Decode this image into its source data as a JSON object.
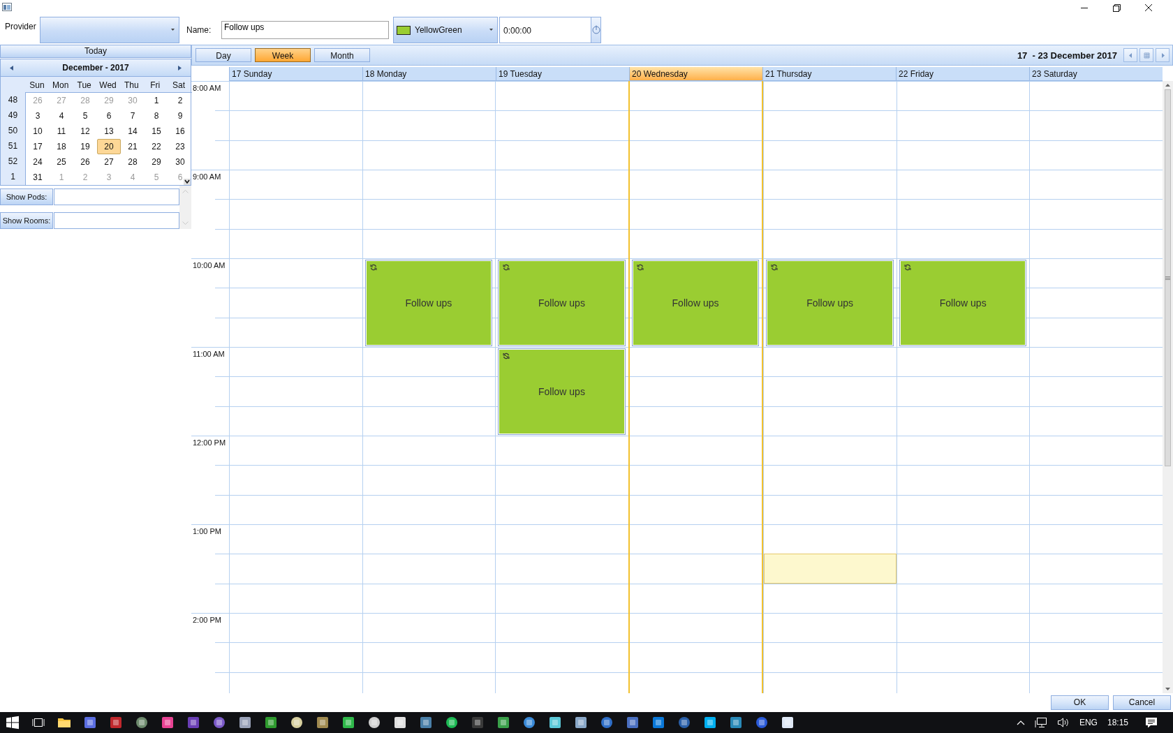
{
  "toolbar": {
    "provider_label": "Provider",
    "name_label": "Name:",
    "name_value": "Follow ups",
    "category": {
      "label": "YellowGreen",
      "color": "#9acd32"
    },
    "time_value": "0:00:00"
  },
  "sidebar": {
    "today_button": "Today",
    "month_title": "December - 2017",
    "weekdays": [
      "Sun",
      "Mon",
      "Tue",
      "Wed",
      "Thu",
      "Fri",
      "Sat"
    ],
    "weeks": [
      {
        "number": "48",
        "days": [
          {
            "label": "26",
            "other_month": true,
            "selected": false
          },
          {
            "label": "27",
            "other_month": true,
            "selected": false
          },
          {
            "label": "28",
            "other_month": true,
            "selected": false
          },
          {
            "label": "29",
            "other_month": true,
            "selected": false
          },
          {
            "label": "30",
            "other_month": true,
            "selected": false
          },
          {
            "label": "1",
            "other_month": false,
            "selected": false
          },
          {
            "label": "2",
            "other_month": false,
            "selected": false
          }
        ]
      },
      {
        "number": "49",
        "days": [
          {
            "label": "3",
            "other_month": false,
            "selected": false
          },
          {
            "label": "4",
            "other_month": false,
            "selected": false
          },
          {
            "label": "5",
            "other_month": false,
            "selected": false
          },
          {
            "label": "6",
            "other_month": false,
            "selected": false
          },
          {
            "label": "7",
            "other_month": false,
            "selected": false
          },
          {
            "label": "8",
            "other_month": false,
            "selected": false
          },
          {
            "label": "9",
            "other_month": false,
            "selected": false
          }
        ]
      },
      {
        "number": "50",
        "days": [
          {
            "label": "10",
            "other_month": false,
            "selected": false
          },
          {
            "label": "11",
            "other_month": false,
            "selected": false
          },
          {
            "label": "12",
            "other_month": false,
            "selected": false
          },
          {
            "label": "13",
            "other_month": false,
            "selected": false
          },
          {
            "label": "14",
            "other_month": false,
            "selected": false
          },
          {
            "label": "15",
            "other_month": false,
            "selected": false
          },
          {
            "label": "16",
            "other_month": false,
            "selected": false
          }
        ]
      },
      {
        "number": "51",
        "days": [
          {
            "label": "17",
            "other_month": false,
            "selected": false
          },
          {
            "label": "18",
            "other_month": false,
            "selected": false
          },
          {
            "label": "19",
            "other_month": false,
            "selected": false
          },
          {
            "label": "20",
            "other_month": false,
            "selected": true
          },
          {
            "label": "21",
            "other_month": false,
            "selected": false
          },
          {
            "label": "22",
            "other_month": false,
            "selected": false
          },
          {
            "label": "23",
            "other_month": false,
            "selected": false
          }
        ]
      },
      {
        "number": "52",
        "days": [
          {
            "label": "24",
            "other_month": false,
            "selected": false
          },
          {
            "label": "25",
            "other_month": false,
            "selected": false
          },
          {
            "label": "26",
            "other_month": false,
            "selected": false
          },
          {
            "label": "27",
            "other_month": false,
            "selected": false
          },
          {
            "label": "28",
            "other_month": false,
            "selected": false
          },
          {
            "label": "29",
            "other_month": false,
            "selected": false
          },
          {
            "label": "30",
            "other_month": false,
            "selected": false
          }
        ]
      },
      {
        "number": "1",
        "days": [
          {
            "label": "31",
            "other_month": false,
            "selected": false
          },
          {
            "label": "1",
            "other_month": true,
            "selected": false
          },
          {
            "label": "2",
            "other_month": true,
            "selected": false
          },
          {
            "label": "3",
            "other_month": true,
            "selected": false
          },
          {
            "label": "4",
            "other_month": true,
            "selected": false
          },
          {
            "label": "5",
            "other_month": true,
            "selected": false
          },
          {
            "label": "6",
            "other_month": true,
            "selected": false
          }
        ]
      }
    ],
    "filters": [
      {
        "label": "Show Pods:"
      },
      {
        "label": "Show Rooms:"
      }
    ]
  },
  "scheduler": {
    "views": [
      {
        "label": "Day",
        "selected": false
      },
      {
        "label": "Week",
        "selected": true
      },
      {
        "label": "Month",
        "selected": false
      }
    ],
    "range_title": "17  - 23 December 2017",
    "days": [
      {
        "label": "17 Sunday",
        "today": false
      },
      {
        "label": "18 Monday",
        "today": false
      },
      {
        "label": "19 Tuesday",
        "today": false
      },
      {
        "label": "20 Wednesday",
        "today": true
      },
      {
        "label": "21 Thursday",
        "today": false
      },
      {
        "label": "22 Friday",
        "today": false
      },
      {
        "label": "23 Saturday",
        "today": false
      }
    ],
    "rows": [
      {
        "time_label": "8:00 AM",
        "cells": [
          {
            "kind": "free"
          },
          {
            "kind": "free"
          },
          {
            "kind": "free"
          },
          {
            "kind": "free"
          },
          {
            "kind": "free"
          },
          {
            "kind": "free"
          },
          {
            "kind": "free"
          }
        ]
      },
      {
        "cells": [
          {
            "kind": "free"
          },
          {
            "kind": "free"
          },
          {
            "kind": "free"
          },
          {
            "kind": "free"
          },
          {
            "kind": "free"
          },
          {
            "kind": "free"
          },
          {
            "kind": "free"
          }
        ]
      },
      {
        "cells": [
          {
            "kind": "free"
          },
          {
            "kind": "free"
          },
          {
            "kind": "free"
          },
          {
            "kind": "free"
          },
          {
            "kind": "free"
          },
          {
            "kind": "free"
          },
          {
            "kind": "free"
          }
        ]
      },
      {
        "time_label": "9:00 AM",
        "cells": [
          {
            "kind": "free"
          },
          {
            "kind": "free"
          },
          {
            "kind": "free"
          },
          {
            "kind": "free"
          },
          {
            "kind": "free"
          },
          {
            "kind": "free"
          },
          {
            "kind": "free"
          }
        ]
      },
      {
        "cells": [
          {
            "kind": "free"
          },
          {
            "kind": "free"
          },
          {
            "kind": "free"
          },
          {
            "kind": "free"
          },
          {
            "kind": "free"
          },
          {
            "kind": "free"
          },
          {
            "kind": "free"
          }
        ]
      },
      {
        "cells": [
          {
            "kind": "free"
          },
          {
            "kind": "free"
          },
          {
            "kind": "free"
          },
          {
            "kind": "free"
          },
          {
            "kind": "free"
          },
          {
            "kind": "free"
          },
          {
            "kind": "free"
          }
        ]
      },
      {
        "time_label": "10:00 AM",
        "cells": [
          {
            "kind": "free"
          },
          {
            "kind": "appointment",
            "subject": "Follow ups",
            "exception": false,
            "color": "#9acd32"
          },
          {
            "kind": "appointment",
            "subject": "Follow ups",
            "exception": false,
            "color": "#9acd32"
          },
          {
            "kind": "appointment",
            "subject": "Follow ups",
            "exception": false,
            "color": "#9acd32"
          },
          {
            "kind": "appointment",
            "subject": "Follow ups",
            "exception": false,
            "color": "#9acd32"
          },
          {
            "kind": "appointment",
            "subject": "Follow ups",
            "exception": false,
            "color": "#9acd32"
          },
          {
            "kind": "free"
          }
        ]
      },
      {
        "cells": [
          {
            "kind": "free"
          },
          {
            "kind": "continued"
          },
          {
            "kind": "continued"
          },
          {
            "kind": "continued"
          },
          {
            "kind": "continued"
          },
          {
            "kind": "continued"
          },
          {
            "kind": "free"
          }
        ]
      },
      {
        "cells": [
          {
            "kind": "free"
          },
          {
            "kind": "continued"
          },
          {
            "kind": "continued"
          },
          {
            "kind": "continued"
          },
          {
            "kind": "continued"
          },
          {
            "kind": "continued"
          },
          {
            "kind": "free"
          }
        ]
      },
      {
        "time_label": "11:00 AM",
        "cells": [
          {
            "kind": "free"
          },
          {
            "kind": "free"
          },
          {
            "kind": "appointment",
            "subject": "Follow ups",
            "exception": true,
            "color": "#9acd32"
          },
          {
            "kind": "free"
          },
          {
            "kind": "free"
          },
          {
            "kind": "free"
          },
          {
            "kind": "free"
          }
        ]
      },
      {
        "cells": [
          {
            "kind": "free"
          },
          {
            "kind": "free"
          },
          {
            "kind": "continued"
          },
          {
            "kind": "free"
          },
          {
            "kind": "free"
          },
          {
            "kind": "free"
          },
          {
            "kind": "free"
          }
        ]
      },
      {
        "cells": [
          {
            "kind": "free"
          },
          {
            "kind": "free"
          },
          {
            "kind": "continued"
          },
          {
            "kind": "free"
          },
          {
            "kind": "free"
          },
          {
            "kind": "free"
          },
          {
            "kind": "free"
          }
        ]
      },
      {
        "time_label": "12:00 PM",
        "cells": [
          {
            "kind": "free"
          },
          {
            "kind": "free"
          },
          {
            "kind": "free"
          },
          {
            "kind": "free"
          },
          {
            "kind": "free"
          },
          {
            "kind": "free"
          },
          {
            "kind": "free"
          }
        ]
      },
      {
        "cells": [
          {
            "kind": "free"
          },
          {
            "kind": "free"
          },
          {
            "kind": "free"
          },
          {
            "kind": "free"
          },
          {
            "kind": "free"
          },
          {
            "kind": "free"
          },
          {
            "kind": "free"
          }
        ]
      },
      {
        "cells": [
          {
            "kind": "free"
          },
          {
            "kind": "free"
          },
          {
            "kind": "free"
          },
          {
            "kind": "free"
          },
          {
            "kind": "free"
          },
          {
            "kind": "free"
          },
          {
            "kind": "free"
          }
        ]
      },
      {
        "time_label": "1:00 PM",
        "cells": [
          {
            "kind": "free"
          },
          {
            "kind": "free"
          },
          {
            "kind": "free"
          },
          {
            "kind": "free"
          },
          {
            "kind": "free"
          },
          {
            "kind": "free"
          },
          {
            "kind": "free"
          }
        ]
      },
      {
        "cells": [
          {
            "kind": "free"
          },
          {
            "kind": "free"
          },
          {
            "kind": "free"
          },
          {
            "kind": "free"
          },
          {
            "kind": "selected"
          },
          {
            "kind": "free"
          },
          {
            "kind": "free"
          }
        ]
      },
      {
        "cells": [
          {
            "kind": "free"
          },
          {
            "kind": "free"
          },
          {
            "kind": "free"
          },
          {
            "kind": "free"
          },
          {
            "kind": "free"
          },
          {
            "kind": "free"
          },
          {
            "kind": "free"
          }
        ]
      },
      {
        "time_label": "2:00 PM",
        "cells": [
          {
            "kind": "free"
          },
          {
            "kind": "free"
          },
          {
            "kind": "free"
          },
          {
            "kind": "free"
          },
          {
            "kind": "free"
          },
          {
            "kind": "free"
          },
          {
            "kind": "free"
          }
        ]
      },
      {
        "cells": [
          {
            "kind": "free"
          },
          {
            "kind": "free"
          },
          {
            "kind": "free"
          },
          {
            "kind": "free"
          },
          {
            "kind": "free"
          },
          {
            "kind": "free"
          },
          {
            "kind": "free"
          }
        ]
      },
      {
        "cells": [
          {
            "kind": "free"
          },
          {
            "kind": "free"
          },
          {
            "kind": "free"
          },
          {
            "kind": "free"
          },
          {
            "kind": "free"
          },
          {
            "kind": "free"
          },
          {
            "kind": "free"
          }
        ]
      }
    ]
  },
  "dialog_buttons": [
    {
      "label": "OK"
    },
    {
      "label": "Cancel"
    }
  ],
  "taskbar": {
    "language": "ENG",
    "clock": "18:15"
  }
}
